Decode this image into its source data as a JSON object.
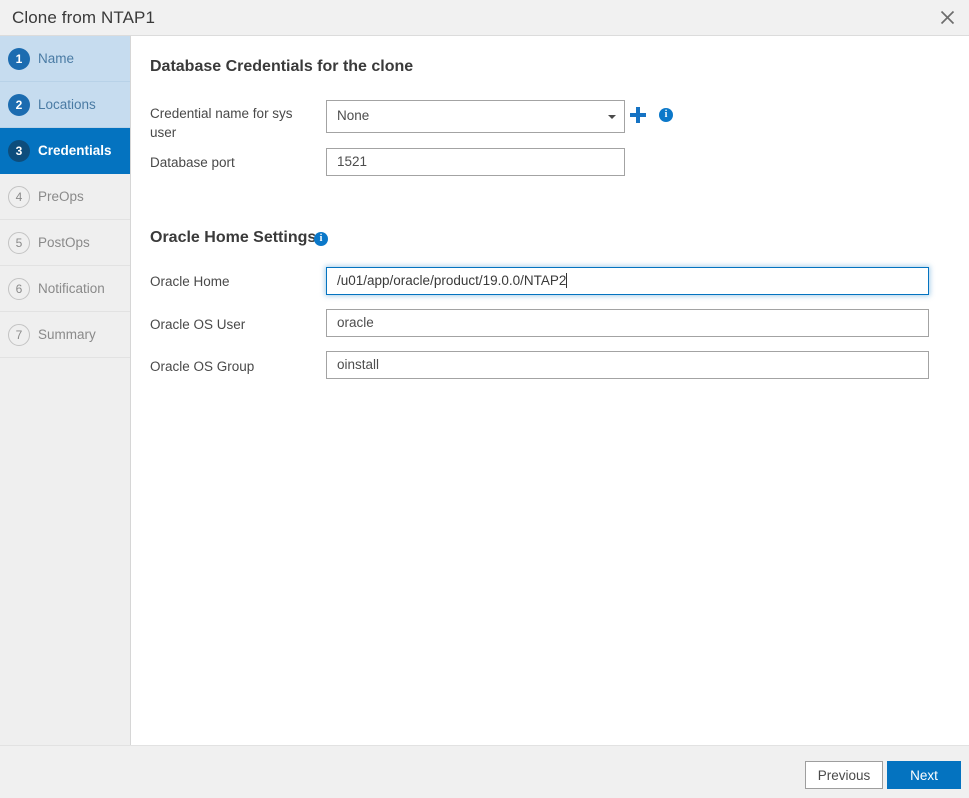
{
  "dialog": {
    "title": "Clone from NTAP1",
    "close_icon": "close-icon"
  },
  "sidebar": {
    "steps": [
      {
        "number": "1",
        "label": "Name",
        "state": "done"
      },
      {
        "number": "2",
        "label": "Locations",
        "state": "done"
      },
      {
        "number": "3",
        "label": "Credentials",
        "state": "active"
      },
      {
        "number": "4",
        "label": "PreOps",
        "state": "pending"
      },
      {
        "number": "5",
        "label": "PostOps",
        "state": "pending"
      },
      {
        "number": "6",
        "label": "Notification",
        "state": "pending"
      },
      {
        "number": "7",
        "label": "Summary",
        "state": "pending"
      }
    ]
  },
  "main": {
    "db_credentials": {
      "heading": "Database Credentials for the clone",
      "sys_credential": {
        "label": "Credential name for sys user",
        "value": "None",
        "chevron_icon": "chevron-down-icon",
        "add_icon": "plus-icon",
        "info_icon": "info-icon"
      },
      "database_port": {
        "label": "Database port",
        "value": "1521",
        "placeholder": "Database port"
      }
    },
    "oracle_home_settings": {
      "heading": "Oracle Home Settings",
      "info_icon": "info-icon",
      "oracle_home": {
        "label": "Oracle Home",
        "value": "/u01/app/oracle/product/19.0.0/NTAP2",
        "placeholder": "Oracle Home"
      },
      "oracle_os_user": {
        "label": "Oracle OS User",
        "value": "oracle",
        "placeholder": "Oracle OS User"
      },
      "oracle_os_group": {
        "label": "Oracle OS Group",
        "value": "oinstall",
        "placeholder": "Oracle OS Group"
      }
    }
  },
  "footer": {
    "previous_label": "Previous",
    "next_label": "Next"
  },
  "colors": {
    "accent": "#0473c0",
    "step_done_bg": "#c6dcef",
    "step_badge_active": "#0d4d7c",
    "info_icon": "#0b78c9",
    "plus_icon": "#1673c4"
  }
}
